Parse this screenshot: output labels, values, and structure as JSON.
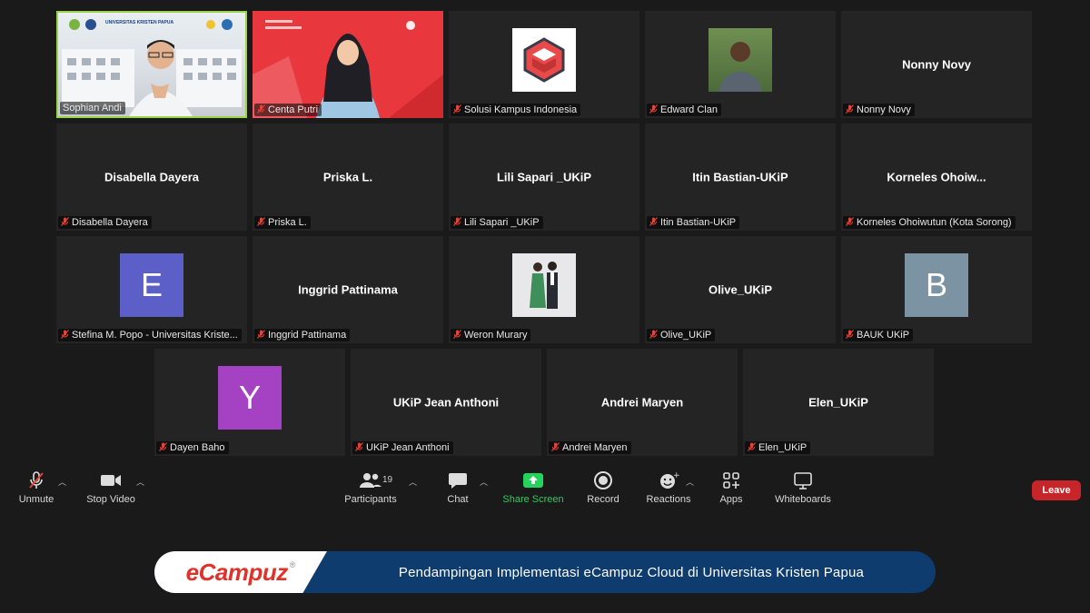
{
  "participants": [
    {
      "display_name": "Sophian Andi",
      "label": "Sophian Andi",
      "type": "video-room",
      "speaking": true,
      "muted": false
    },
    {
      "display_name": "Centa Putri",
      "label": "Centa Putri",
      "type": "video-red",
      "speaking": false,
      "muted": true
    },
    {
      "display_name": "Solusi Kampus Indonesia",
      "label": "Solusi Kampus Indonesia",
      "type": "logo",
      "muted": true
    },
    {
      "display_name": "Edward Clan",
      "label": "Edward Clan",
      "type": "photo-green",
      "muted": true
    },
    {
      "display_name": "Nonny Novy",
      "label": "Nonny Novy",
      "type": "name",
      "muted": true
    },
    {
      "display_name": "Disabella Dayera",
      "label": "Disabella Dayera",
      "type": "name",
      "muted": true
    },
    {
      "display_name": "Priska L.",
      "label": "Priska L.",
      "type": "name",
      "muted": true
    },
    {
      "display_name": "Lili Sapari _UKiP",
      "label": "Lili Sapari _UKiP",
      "type": "name",
      "muted": true
    },
    {
      "display_name": "Itin Bastian-UKiP",
      "label": "Itin Bastian-UKiP",
      "type": "name",
      "muted": true
    },
    {
      "display_name": "Korneles  Ohoiw...",
      "label": "Korneles Ohoiwutun (Kota Sorong)",
      "type": "name",
      "muted": true
    },
    {
      "display_name": "E",
      "label": "Stefina M. Popo - Universitas Kriste...",
      "type": "avatar",
      "avatar_color": "#5b5fc7",
      "muted": true
    },
    {
      "display_name": "Inggrid Pattinama",
      "label": "Inggrid Pattinama",
      "type": "name",
      "muted": true
    },
    {
      "display_name": "Weron Murary",
      "label": "Weron Murary",
      "type": "photo-couple",
      "muted": true
    },
    {
      "display_name": "Olive_UKiP",
      "label": "Olive_UKiP",
      "type": "name",
      "muted": true
    },
    {
      "display_name": "B",
      "label": "BAUK UKiP",
      "type": "avatar",
      "avatar_color": "#7b93a3",
      "muted": true
    },
    {
      "display_name": "Y",
      "label": "Dayen Baho",
      "type": "avatar",
      "avatar_color": "#a542c4",
      "muted": true
    },
    {
      "display_name": "UKiP Jean Anthoni",
      "label": "UKiP Jean Anthoni",
      "type": "name",
      "muted": true
    },
    {
      "display_name": "Andrei Maryen",
      "label": "Andrei Maryen",
      "type": "name",
      "muted": true
    },
    {
      "display_name": "Elen_UKiP",
      "label": "Elen_UKiP",
      "type": "name",
      "muted": true
    }
  ],
  "slide_header": "UNIVERSITAS KRISTEN PAPUA",
  "toolbar": {
    "unmute": "Unmute",
    "stop_video": "Stop Video",
    "participants": "Participants",
    "participants_count": "19",
    "chat": "Chat",
    "share_screen": "Share Screen",
    "record": "Record",
    "reactions": "Reactions",
    "apps": "Apps",
    "whiteboards": "Whiteboards",
    "leave": "Leave"
  },
  "colors": {
    "share_screen": "#23d35a",
    "leave": "#c8252a",
    "speaking_border": "#9bd34a",
    "mic_off": "#e0453a"
  },
  "banner": {
    "logo": "eCampuz",
    "text": "Pendampingan Implementasi eCampuz Cloud di Universitas Kristen Papua"
  }
}
